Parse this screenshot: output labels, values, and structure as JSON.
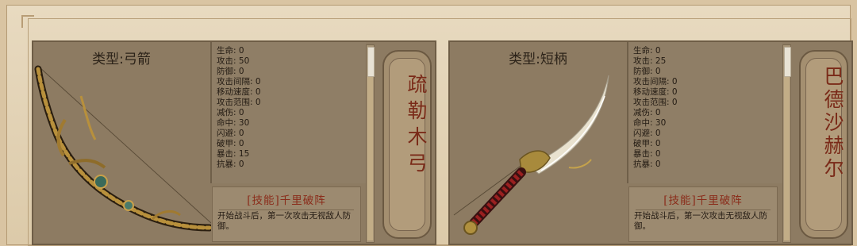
{
  "cards": [
    {
      "type_label": "类型:弓箭",
      "weapon_name": "疏勒木弓",
      "stats": [
        {
          "label": "生命:",
          "value": "0"
        },
        {
          "label": "攻击:",
          "value": "50"
        },
        {
          "label": "防御:",
          "value": "0"
        },
        {
          "label": "攻击间隔:",
          "value": "0"
        },
        {
          "label": "移动速度:",
          "value": "0"
        },
        {
          "label": "攻击范围:",
          "value": "0"
        },
        {
          "label": "减伤:",
          "value": "0"
        },
        {
          "label": "命中:",
          "value": "30"
        },
        {
          "label": "闪避:",
          "value": "0"
        },
        {
          "label": "破甲:",
          "value": "0"
        },
        {
          "label": "暴击:",
          "value": "15"
        },
        {
          "label": "抗暴:",
          "value": "0"
        }
      ],
      "skill_title": "[技能]千里破阵",
      "skill_desc": "开始战斗后，第一次攻击无视敌人防御。"
    },
    {
      "type_label": "类型:短柄",
      "weapon_name": "巴德沙赫尔",
      "stats": [
        {
          "label": "生命:",
          "value": "0"
        },
        {
          "label": "攻击:",
          "value": "25"
        },
        {
          "label": "防御:",
          "value": "0"
        },
        {
          "label": "攻击间隔:",
          "value": "0"
        },
        {
          "label": "移动速度:",
          "value": "0"
        },
        {
          "label": "攻击范围:",
          "value": "0"
        },
        {
          "label": "减伤:",
          "value": "0"
        },
        {
          "label": "命中:",
          "value": "30"
        },
        {
          "label": "闪避:",
          "value": "0"
        },
        {
          "label": "破甲:",
          "value": "0"
        },
        {
          "label": "暴击:",
          "value": "0"
        },
        {
          "label": "抗暴:",
          "value": "0"
        }
      ],
      "skill_title": "[技能]千里破阵",
      "skill_desc": "开始战斗后，第一次攻击无视敌人防御。"
    }
  ]
}
